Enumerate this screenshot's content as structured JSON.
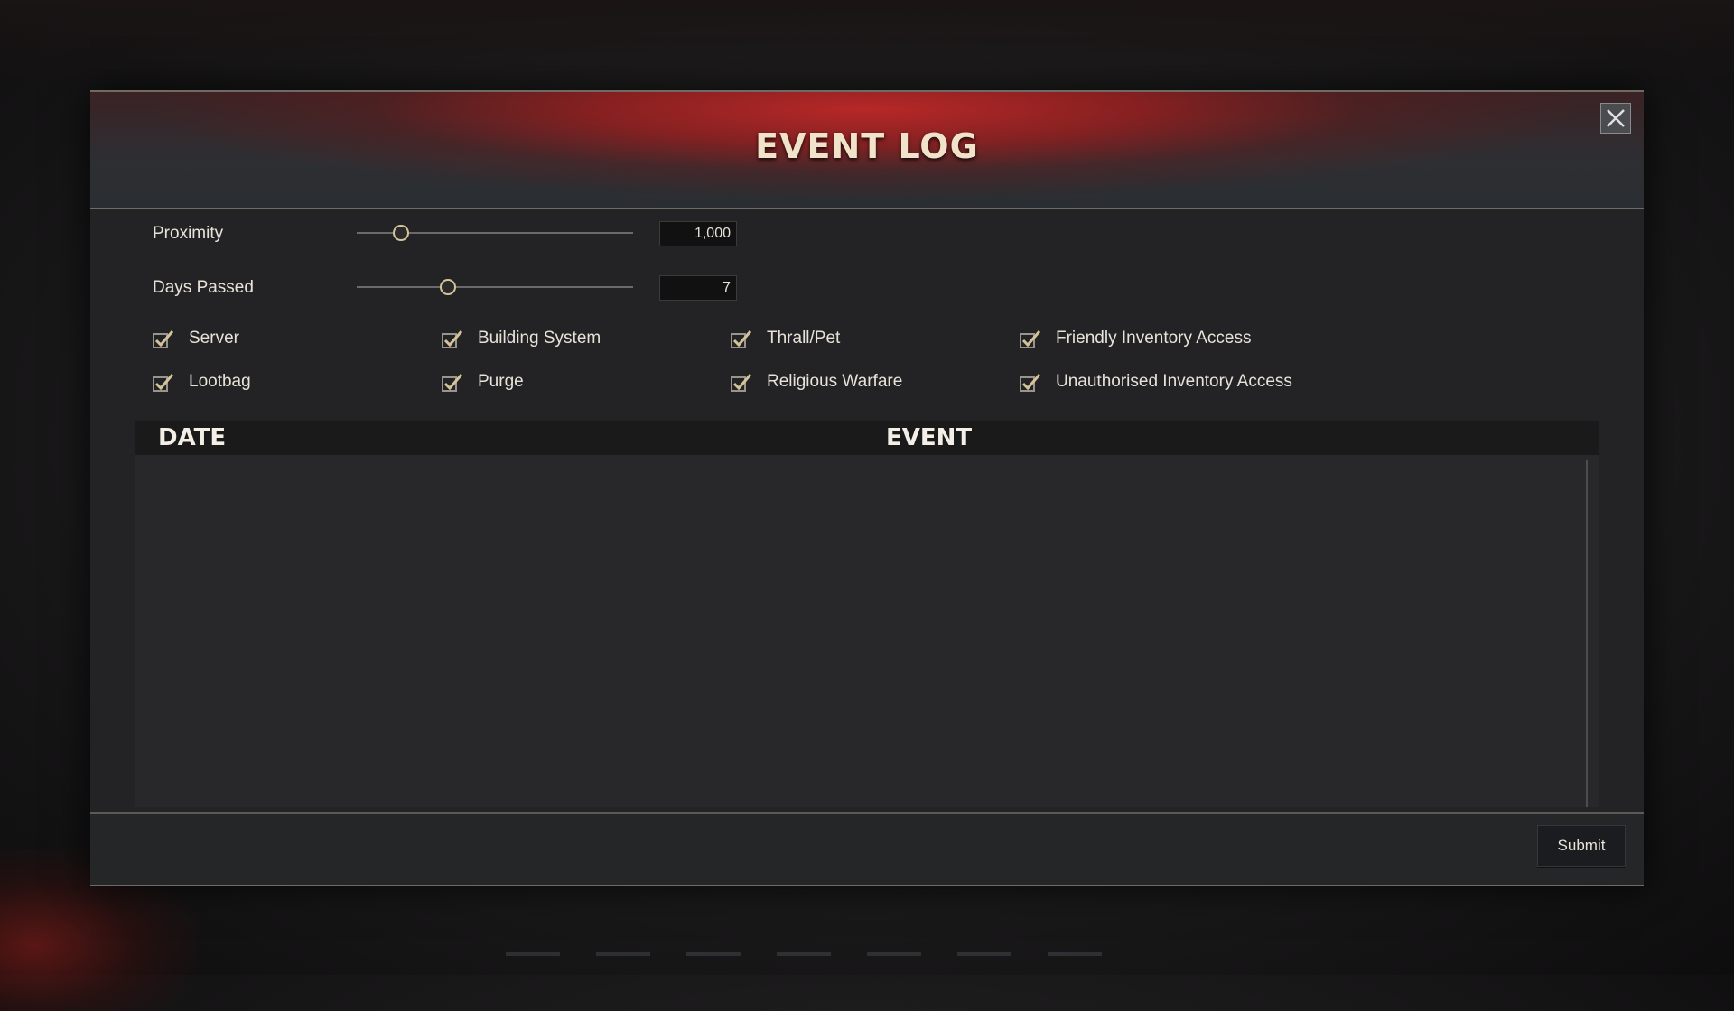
{
  "window": {
    "title": "EVENT LOG"
  },
  "filters": {
    "proximity": {
      "label": "Proximity",
      "value": "1,000",
      "slider_fraction": 0.16
    },
    "days_passed": {
      "label": "Days Passed",
      "value": "7",
      "slider_fraction": 0.33
    }
  },
  "categories": [
    {
      "label": "Server",
      "checked": true
    },
    {
      "label": "Building System",
      "checked": true
    },
    {
      "label": "Thrall/Pet",
      "checked": true
    },
    {
      "label": "Friendly Inventory Access",
      "checked": true
    },
    {
      "label": "Lootbag",
      "checked": true
    },
    {
      "label": "Purge",
      "checked": true
    },
    {
      "label": "Religious Warfare",
      "checked": true
    },
    {
      "label": "Unauthorised Inventory Access",
      "checked": true
    }
  ],
  "table": {
    "columns": [
      "DATE",
      "EVENT"
    ],
    "rows": []
  },
  "footer": {
    "submit_label": "Submit"
  },
  "colors": {
    "accent_red": "#b22a2a",
    "title_text": "#f1e3c9",
    "checkmark": "#d4c39a"
  }
}
